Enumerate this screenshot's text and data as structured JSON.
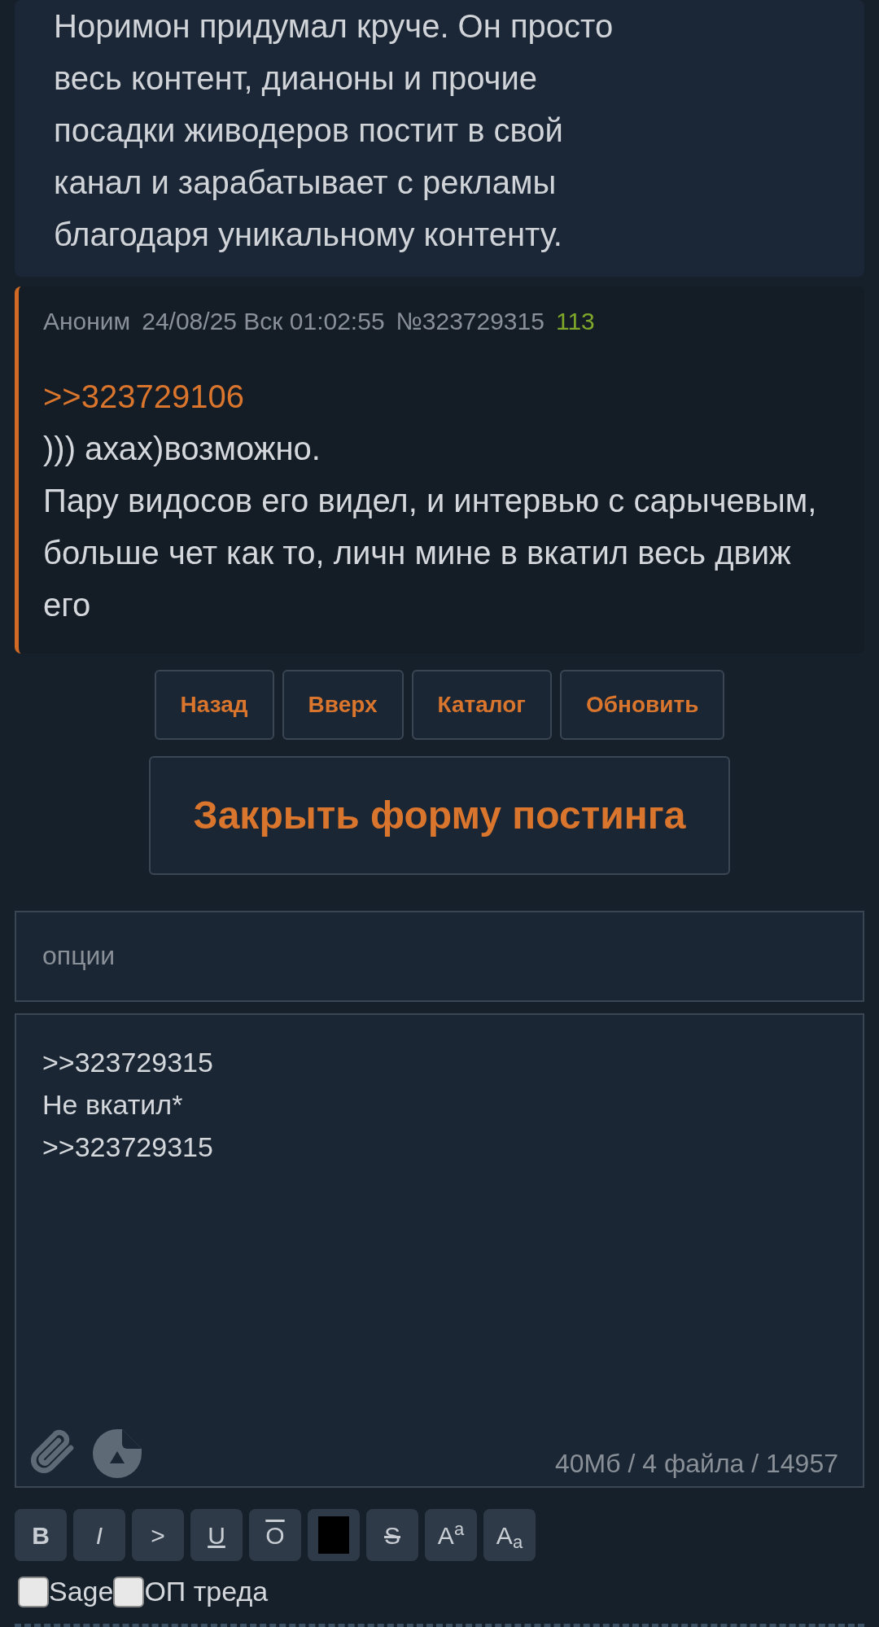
{
  "previous_post": {
    "lines": [
      "Норимон придумал круче. Он просто",
      "весь контент, дианоны и прочие",
      "посадки живодеров постит в свой",
      "канал и зарабатывает с рекламы",
      "благодаря уникальному контенту."
    ]
  },
  "post": {
    "author": "Аноним",
    "date": "24/08/25 Вск 01:02:55",
    "number": "№323729315",
    "index": "113",
    "reply_link": ">>323729106",
    "lines": [
      "))) ахах)возможно.",
      "Пару видосов его видел, и интервью с сарычевым, больше чет как то, личн мине в вкатил весь движ его"
    ]
  },
  "nav_buttons": [
    "Назад",
    "Вверх",
    "Каталог",
    "Обновить"
  ],
  "close_form_button": "Закрыть форму постинга",
  "options_field": {
    "placeholder": "опции"
  },
  "message_field": {
    "value": ">>323729315\nНе вкатил*\n>>323729315"
  },
  "limits": "40Мб / 4 файла / 14957",
  "format_buttons": [
    {
      "kind": "bold",
      "label": "B"
    },
    {
      "kind": "italic",
      "label": "I"
    },
    {
      "kind": "quote",
      "label": ">"
    },
    {
      "kind": "underline",
      "label": "U"
    },
    {
      "kind": "overline",
      "label": "O"
    },
    {
      "kind": "spoiler"
    },
    {
      "kind": "strike",
      "label": "S"
    },
    {
      "kind": "sup",
      "label": "A",
      "small": "a"
    },
    {
      "kind": "sub",
      "label": "A",
      "small": "a"
    }
  ],
  "checkboxes": [
    {
      "label": "Sage",
      "checked": false
    },
    {
      "label": "ОП треда",
      "checked": false
    }
  ]
}
